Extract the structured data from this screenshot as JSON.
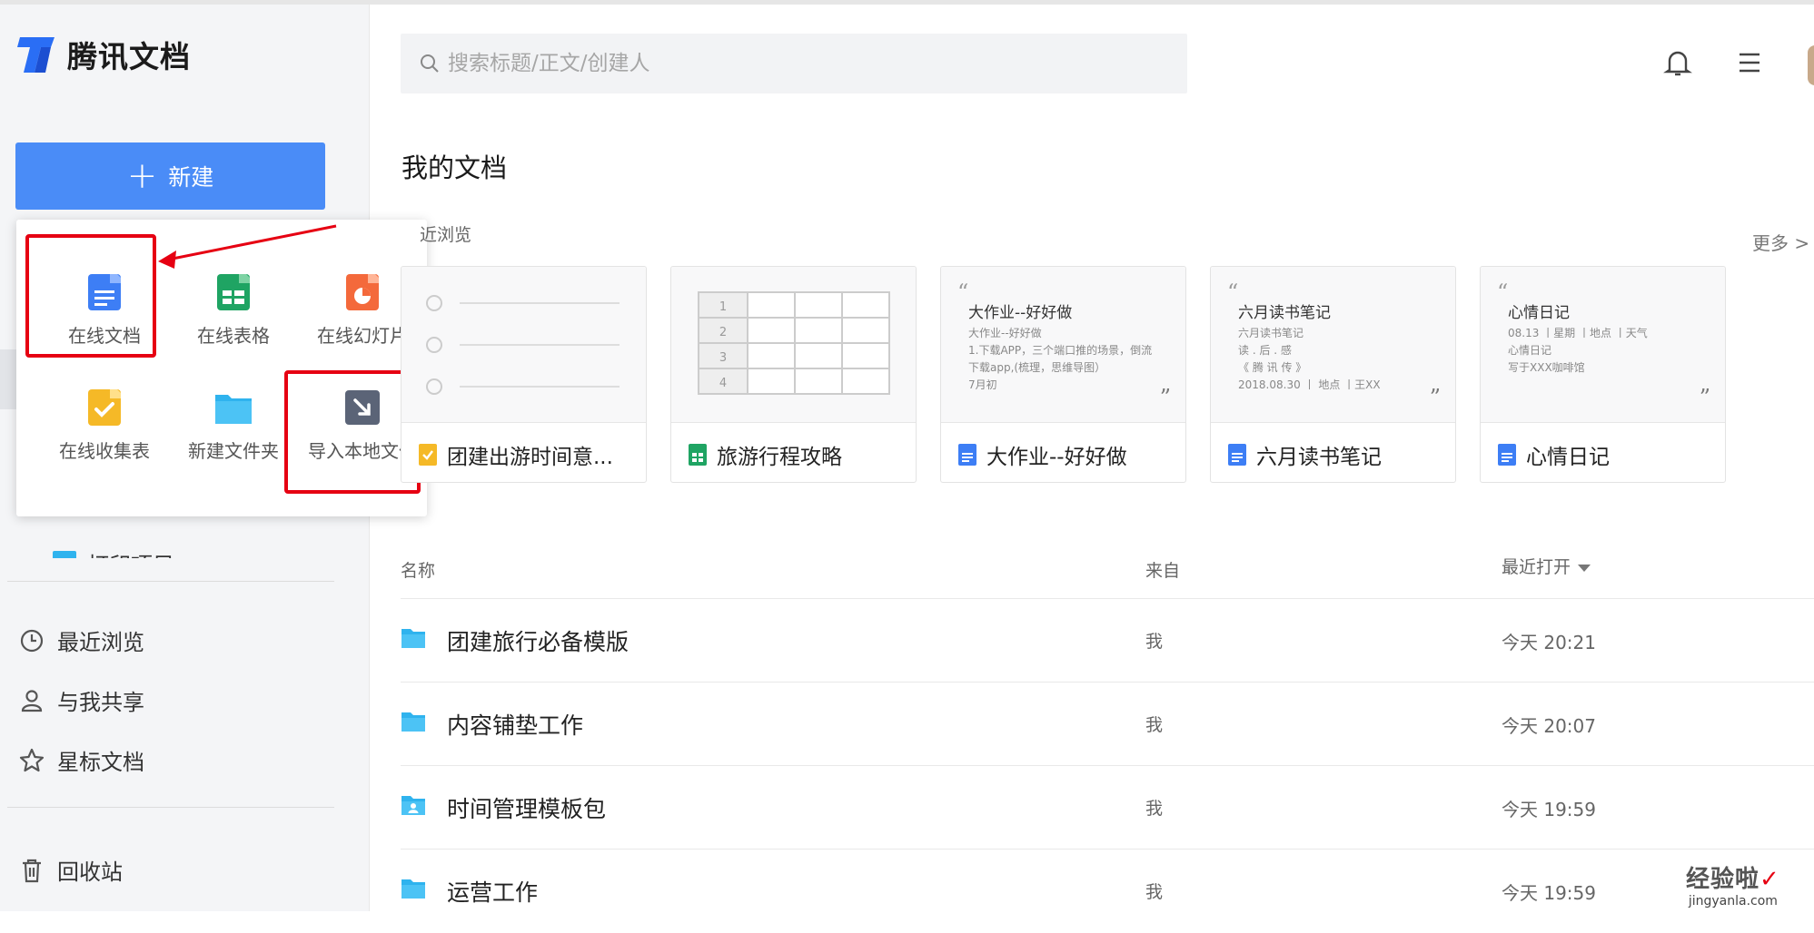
{
  "app": {
    "name": "腾讯文档"
  },
  "sidebar": {
    "new_button": "新建",
    "peek_item": "打印项目",
    "nav": [
      {
        "label": "最近浏览",
        "icon": "clock-icon"
      },
      {
        "label": "与我共享",
        "icon": "user-icon"
      },
      {
        "label": "星标文档",
        "icon": "star-icon"
      },
      {
        "label": "回收站",
        "icon": "trash-icon"
      }
    ]
  },
  "new_menu": {
    "items": [
      {
        "label": "在线文档",
        "icon": "doc-icon",
        "color": "#3d7ef5"
      },
      {
        "label": "在线表格",
        "icon": "sheet-icon",
        "color": "#1fa463"
      },
      {
        "label": "在线幻灯片",
        "icon": "slides-icon",
        "color": "#f4693b"
      },
      {
        "label": "在线收集表",
        "icon": "form-icon",
        "color": "#f5b927"
      },
      {
        "label": "新建文件夹",
        "icon": "folder-icon",
        "color": "#2fb3ee"
      },
      {
        "label": "导入本地文件",
        "icon": "import-icon",
        "color": "#5b6477"
      }
    ],
    "highlight_color": "#e60012"
  },
  "search": {
    "placeholder": "搜索标题/正文/创建人"
  },
  "header": {
    "bell_icon": "bell-icon",
    "menu_icon": "menu-icon"
  },
  "main": {
    "title": "我的文档",
    "recent_label": "近浏览",
    "more": "更多 >",
    "cards": [
      {
        "name": "团建出游时间意...",
        "type": "form"
      },
      {
        "name": "旅游行程攻略",
        "type": "sheet",
        "row_numbers": [
          "1",
          "2",
          "3",
          "4"
        ]
      },
      {
        "name": "大作业--好好做",
        "type": "doc",
        "preview_title": "大作业--好好做",
        "preview_lines": [
          "大作业--好好做",
          "1.下载APP，三个端口推的场景，倒流",
          "下载app,(梳理，思维导图）",
          "7月初"
        ]
      },
      {
        "name": "六月读书笔记",
        "type": "doc",
        "preview_title": "六月读书笔记",
        "preview_lines": [
          "六月读书笔记",
          "读 . 后 . 感",
          "《 腾 讯 传 》",
          "2018.08.30 丨 地点 丨王XX"
        ]
      },
      {
        "name": "心情日记",
        "type": "doc",
        "preview_title": "心情日记",
        "preview_lines": [
          "08.13 丨星期 丨地点 丨天气",
          "心情日记",
          "写于XXX咖啡馆"
        ]
      }
    ],
    "quote_open": "“",
    "quote_close": "”",
    "table": {
      "headers": {
        "name": "名称",
        "from": "来自",
        "opened": "最近打开"
      },
      "rows": [
        {
          "name": "团建旅行必备模版",
          "from": "我",
          "time": "今天 20:21",
          "icon": "folder-icon"
        },
        {
          "name": "内容铺垫工作",
          "from": "我",
          "time": "今天 20:07",
          "icon": "folder-icon"
        },
        {
          "name": "时间管理模板包",
          "from": "我",
          "time": "今天 19:59",
          "icon": "shared-folder-icon"
        },
        {
          "name": "运营工作",
          "from": "我",
          "time": "今天 19:59",
          "icon": "folder-icon"
        }
      ]
    }
  },
  "watermark": {
    "line1": "经验啦",
    "check": "✓",
    "line2": "jingyanla.com"
  }
}
